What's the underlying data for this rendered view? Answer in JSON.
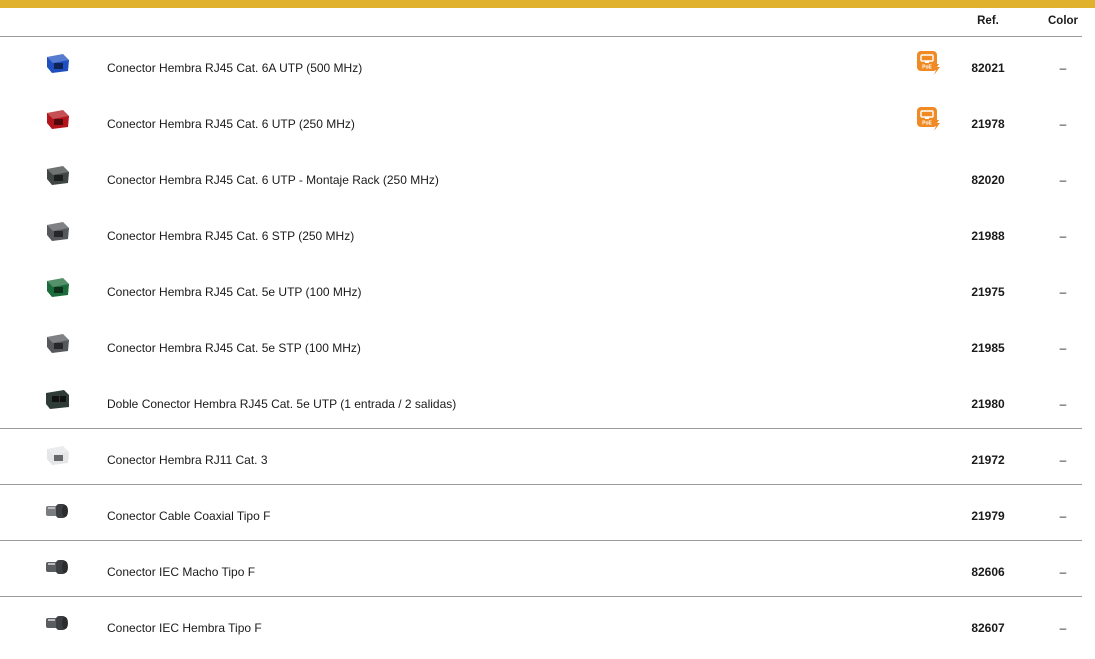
{
  "header": {
    "ref_label": "Ref.",
    "color_label": "Color"
  },
  "colors": {
    "accent_bar": "#e0b12c",
    "poe_badge": "#f08a24"
  },
  "rows": [
    {
      "description": "Conector Hembra RJ45 Cat. 6A UTP (500 MHz)",
      "ref": "82021",
      "color": "–",
      "poe": true,
      "poe_label": "PoE",
      "thumb": "blue-rj45-jack",
      "thumb_color": "#1f4fbf"
    },
    {
      "description": "Conector Hembra RJ45 Cat. 6 UTP (250 MHz)",
      "ref": "21978",
      "color": "–",
      "poe": true,
      "poe_label": "PoE",
      "thumb": "red-rj45-jack",
      "thumb_color": "#b3141c"
    },
    {
      "description": "Conector Hembra RJ45 Cat. 6 UTP - Montaje Rack (250 MHz)",
      "ref": "82020",
      "color": "–",
      "poe": false,
      "thumb": "dark-grey-rj45-jack",
      "thumb_color": "#3f4643"
    },
    {
      "description": "Conector Hembra RJ45 Cat. 6 STP (250 MHz)",
      "ref": "21988",
      "color": "–",
      "poe": false,
      "thumb": "grey-shielded-rj45-jack",
      "thumb_color": "#55585a"
    },
    {
      "description": "Conector Hembra RJ45 Cat. 5e UTP (100 MHz)",
      "ref": "21975",
      "color": "–",
      "poe": false,
      "thumb": "green-rj45-jack",
      "thumb_color": "#1c6b3a"
    },
    {
      "description": "Conector Hembra RJ45 Cat. 5e STP (100 MHz)",
      "ref": "21985",
      "color": "–",
      "poe": false,
      "thumb": "grey-shielded-rj45-jack",
      "thumb_color": "#55585a"
    },
    {
      "description": "Doble Conector Hembra RJ45 Cat. 5e UTP (1 entrada / 2 salidas)",
      "ref": "21980",
      "color": "–",
      "poe": false,
      "thumb": "double-rj45-jack",
      "thumb_color": "#2f3b36"
    },
    {
      "description": "Conector Hembra RJ11 Cat. 3",
      "ref": "21972",
      "color": "–",
      "poe": false,
      "thumb": "white-rj11-jack",
      "thumb_color": "#e4e6e8"
    },
    {
      "description": "Conector Cable Coaxial Tipo F",
      "ref": "21979",
      "color": "–",
      "poe": false,
      "thumb": "coaxial-f-connector",
      "thumb_color": "#7a7d80"
    },
    {
      "description": "Conector IEC Macho Tipo F",
      "ref": "82606",
      "color": "–",
      "poe": false,
      "thumb": "iec-male-connector",
      "thumb_color": "#5a5d60"
    },
    {
      "description": "Conector IEC Hembra Tipo F",
      "ref": "82607",
      "color": "–",
      "poe": false,
      "thumb": "iec-female-connector",
      "thumb_color": "#5a5d60"
    }
  ]
}
